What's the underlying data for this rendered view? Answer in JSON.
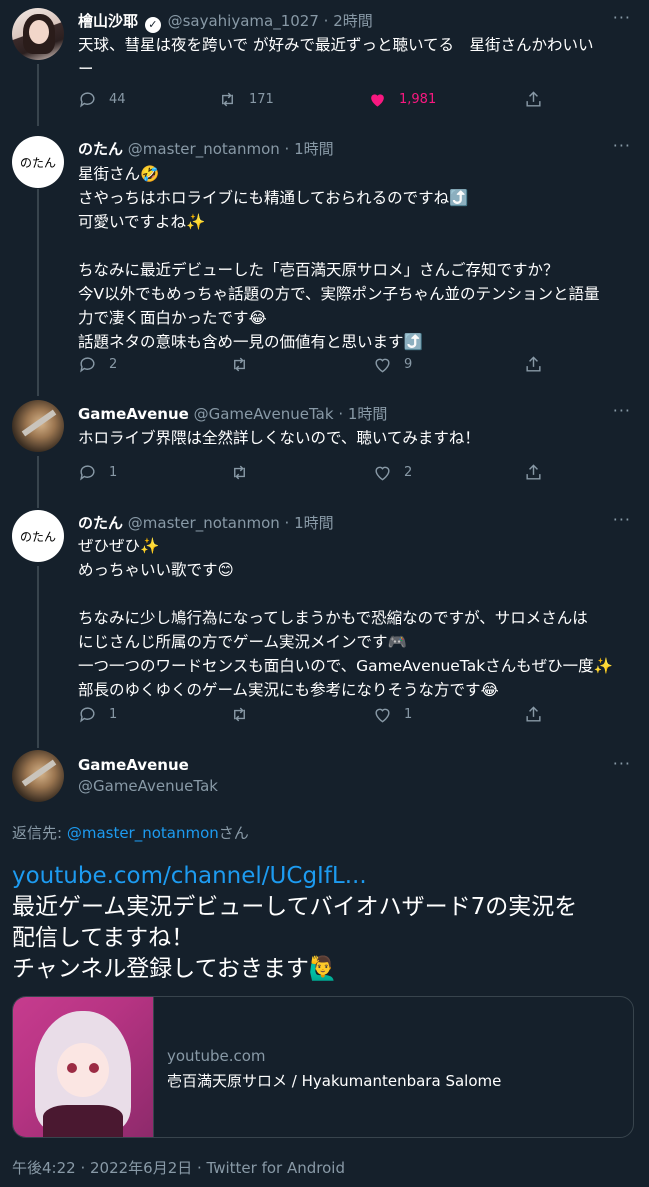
{
  "tweets": [
    {
      "name": "檜山沙耶",
      "handle": "@sayahiyama_1027",
      "time": "2時間",
      "lines": [
        "天球、彗星は夜を跨いで が好みで最近ずっと聴いてる　星街さんかわいい",
        "ー"
      ],
      "replies": "44",
      "retweets": "171",
      "likes": "1,981"
    },
    {
      "name": "のたん",
      "handle": "@master_notanmon",
      "time": "1時間",
      "avatar_text": "のたん",
      "lines": [
        "星街さん🤣",
        "さやっちはホロライブにも精通しておられるのですね⤴️",
        "可愛いですよね✨",
        "",
        "ちなみに最近デビューした「壱百満天原サロメ」さんご存知ですか？",
        "今V以外でもめっちゃ話題の方で、実際ポン子ちゃん並のテンションと語量",
        "力で凄く面白かったです😂",
        "話題ネタの意味も含め一見の価値有と思います⤴️"
      ],
      "replies": "2",
      "retweets": "",
      "likes": "9"
    },
    {
      "name": "GameAvenue",
      "handle": "@GameAvenueTak",
      "time": "1時間",
      "lines": [
        "ホロライブ界隈は全然詳しくないので、聴いてみますね！"
      ],
      "replies": "1",
      "retweets": "",
      "likes": "2"
    },
    {
      "name": "のたん",
      "handle": "@master_notanmon",
      "time": "1時間",
      "avatar_text": "のたん",
      "lines": [
        "ぜひぜひ✨",
        "めっちゃいい歌です😊",
        "",
        "ちなみに少し鳩行為になってしまうかもで恐縮なのですが、サロメさんは",
        "にじさんじ所属の方でゲーム実況メインです🎮",
        "一つ一つのワードセンスも面白いので、GameAvenueTakさんもぜひ一度✨",
        "部長のゆくゆくのゲーム実況にも参考になりそうな方です😂"
      ],
      "replies": "1",
      "retweets": "",
      "likes": "1"
    }
  ],
  "focus": {
    "name": "GameAvenue",
    "handle": "@GameAvenueTak",
    "reply_to_prefix": "返信先: ",
    "reply_to_handle": "@master_notanmon",
    "reply_to_suffix": "さん",
    "link": "youtube.com/channel/UCgIfL...",
    "lines": [
      "最近ゲーム実況デビューしてバイオハザード7の実況を",
      "配信してますね！",
      "チャンネル登録しておきます🙋‍♂️"
    ],
    "card_domain": "youtube.com",
    "card_title": "壱百満天原サロメ / Hyakumantenbara Salome",
    "meta": "午後4:22 · 2022年6月2日 · Twitter for Android"
  },
  "icons": {
    "reply": "reply-icon",
    "retweet": "retweet-icon",
    "like": "heart-icon",
    "share": "share-icon",
    "more": "more-icon",
    "verified": "verified-icon"
  },
  "colors": {
    "background": "#15202b",
    "secondary_text": "#8899a6",
    "link": "#1d9bf0",
    "like_active": "#f91880"
  }
}
